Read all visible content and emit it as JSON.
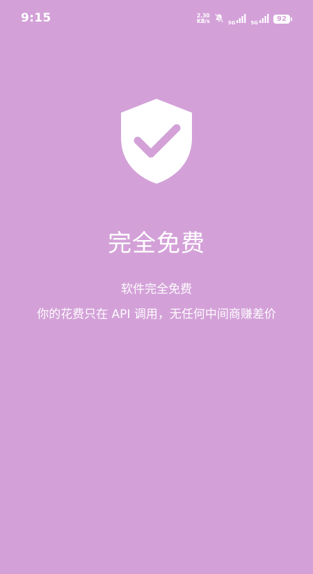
{
  "status_bar": {
    "time": "9:15",
    "net_speed_value": "2.30",
    "net_speed_unit": "KB/s",
    "sim1_type": "5G",
    "sim2_type": "5G",
    "battery_level": "92",
    "icons": [
      "notifications-off-icon",
      "signal-icon",
      "signal-icon",
      "battery-icon"
    ]
  },
  "hero": {
    "icon": "shield-check-icon",
    "title": "完全免费",
    "line1": "软件完全免费",
    "line2": "你的花费只在 API 调用，无任何中间商赚差价"
  },
  "colors": {
    "background": "#D3A1D8",
    "foreground": "#FFFFFF"
  }
}
